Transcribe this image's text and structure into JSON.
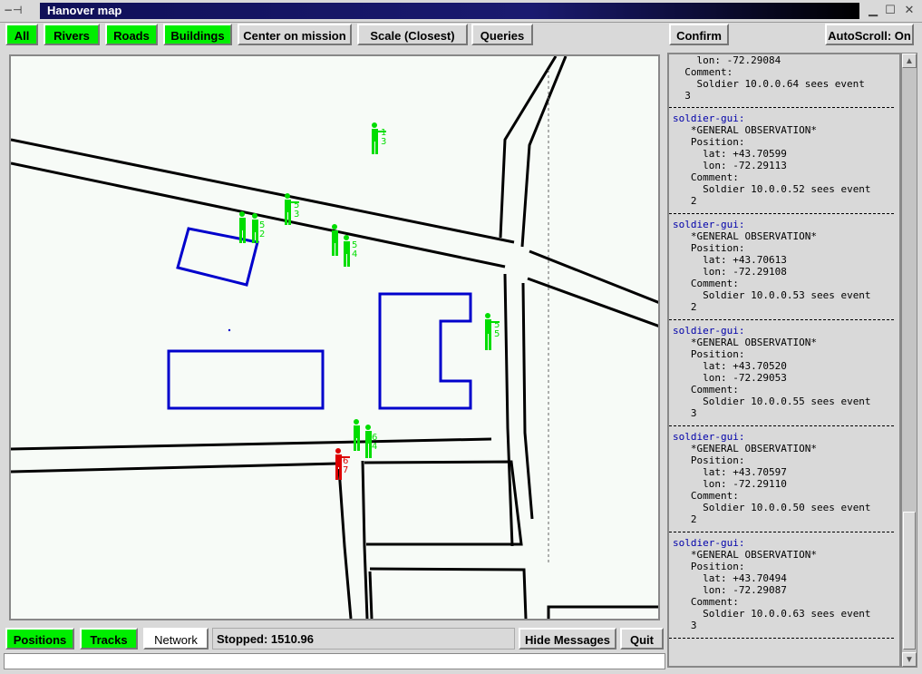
{
  "window": {
    "title": "Hanover map",
    "pin_glyph": "−⊣"
  },
  "toolbar": {
    "all": "All",
    "rivers": "Rivers",
    "roads": "Roads",
    "buildings": "Buildings",
    "center": "Center on mission",
    "scale": "Scale (Closest)",
    "queries": "Queries",
    "confirm": "Confirm",
    "autoscroll": "AutoScroll: On"
  },
  "bottom": {
    "positions": "Positions",
    "tracks": "Tracks",
    "network": "Network",
    "status": "Stopped: 1510.96",
    "hide_messages": "Hide Messages",
    "quit": "Quit"
  },
  "colors": {
    "friendly": "#00dd00",
    "hostile": "#dd0000",
    "building": "#0000cc",
    "road": "#000000"
  },
  "units": [
    {
      "label": "1\n3",
      "color": "friendly"
    },
    {
      "label": "5\n3",
      "color": "friendly"
    },
    {
      "label": "5\n2",
      "color": "friendly"
    },
    {
      "label": "5\n4",
      "color": "friendly"
    },
    {
      "label": "5\n5",
      "color": "friendly"
    },
    {
      "label": "6\n4",
      "color": "friendly"
    },
    {
      "label": "6\n7",
      "color": "hostile"
    }
  ],
  "messages_partial": "    lon: -72.29084\n  Comment:\n    Soldier 10.0.0.64 sees event\n  3",
  "messages": [
    {
      "source": "soldier-gui:",
      "type": "*GENERAL OBSERVATION*",
      "lat": "+43.70599",
      "lon": "-72.29113",
      "comment": "Soldier 10.0.0.52 sees event",
      "value": "2"
    },
    {
      "source": "soldier-gui:",
      "type": "*GENERAL OBSERVATION*",
      "lat": "+43.70613",
      "lon": "-72.29108",
      "comment": "Soldier 10.0.0.53 sees event",
      "value": "2"
    },
    {
      "source": "soldier-gui:",
      "type": "*GENERAL OBSERVATION*",
      "lat": "+43.70520",
      "lon": "-72.29053",
      "comment": "Soldier 10.0.0.55 sees event",
      "value": "3"
    },
    {
      "source": "soldier-gui:",
      "type": "*GENERAL OBSERVATION*",
      "lat": "+43.70597",
      "lon": "-72.29110",
      "comment": "Soldier 10.0.0.50 sees event",
      "value": "2"
    },
    {
      "source": "soldier-gui:",
      "type": "*GENERAL OBSERVATION*",
      "lat": "+43.70494",
      "lon": "-72.29087",
      "comment": "Soldier 10.0.0.63 sees event",
      "value": "3"
    }
  ]
}
